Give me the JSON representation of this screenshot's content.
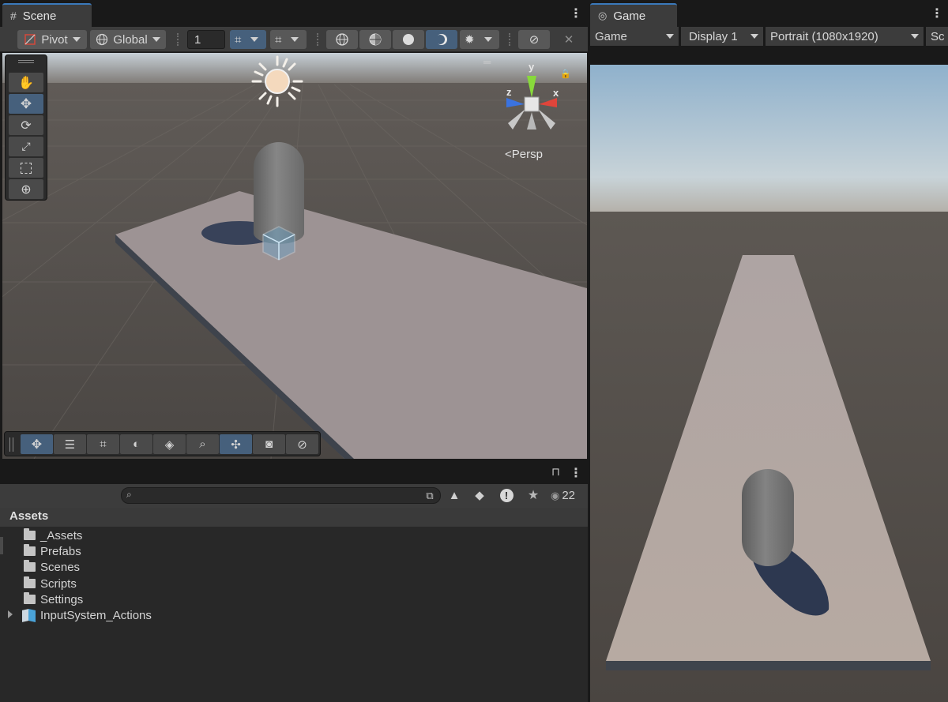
{
  "scene": {
    "tab_title": "Scene",
    "pivot_label": "Pivot",
    "global_label": "Global",
    "grid_size_value": "1",
    "persp_label": "Persp",
    "axis_x": "x",
    "axis_y": "y",
    "axis_z": "z"
  },
  "game": {
    "tab_title": "Game",
    "mode_label": "Game",
    "display_label": "Display 1",
    "resolution_label": "Portrait (1080x1920)",
    "scale_label": "Sc"
  },
  "project": {
    "search_placeholder": "",
    "visibility_count": "22",
    "root_label": "Assets",
    "items": [
      {
        "label": "_Assets",
        "icon": "folder-icon"
      },
      {
        "label": "Prefabs",
        "icon": "folder-icon"
      },
      {
        "label": "Scenes",
        "icon": "folder-icon"
      },
      {
        "label": "Scripts",
        "icon": "folder-icon"
      },
      {
        "label": "Settings",
        "icon": "folder-icon"
      },
      {
        "label": "InputSystem_Actions",
        "icon": "input-actions-icon"
      }
    ]
  },
  "colors": {
    "accent": "#3a79bb",
    "active_button": "#46607c",
    "panel_bg": "#282828",
    "toolbar_bg": "#3c3c3c",
    "gizmo_x": "#e0453b",
    "gizmo_y": "#88d93b",
    "gizmo_z": "#3a73e0"
  }
}
